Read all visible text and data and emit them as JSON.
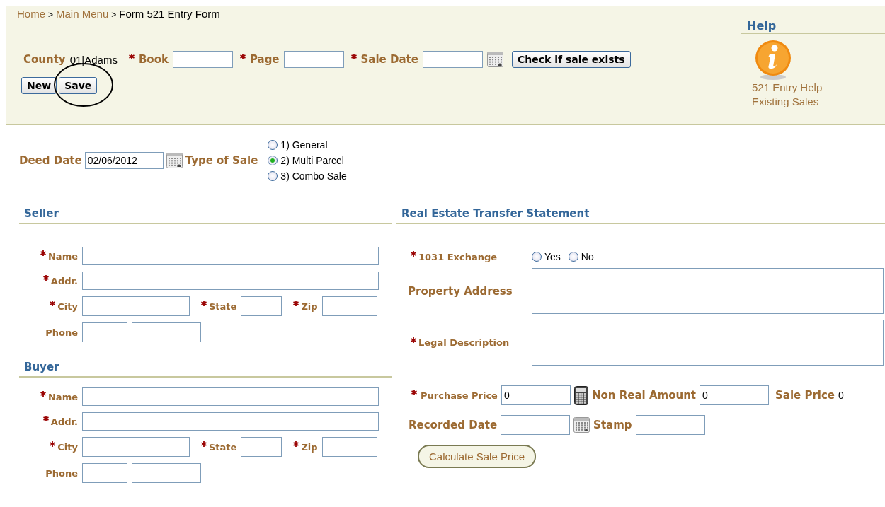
{
  "breadcrumb": {
    "separator": ">",
    "items": [
      {
        "label": "Home",
        "link": true
      },
      {
        "label": "Main Menu",
        "link": true
      },
      {
        "label": "Form 521 Entry Form",
        "link": false
      }
    ]
  },
  "header": {
    "county_label": "County",
    "county_value": "01|Adams",
    "fields": [
      {
        "label": "Book",
        "required": true,
        "calendar": false
      },
      {
        "label": "Page",
        "required": true,
        "calendar": false
      },
      {
        "label": "Sale Date",
        "required": true,
        "calendar": true
      }
    ],
    "check_button": "Check if sale exists",
    "buttons": [
      {
        "label": "New",
        "circled": false
      },
      {
        "label": "Save",
        "circled": true
      }
    ]
  },
  "help": {
    "title": "Help",
    "links": [
      "521 Entry Help",
      "Existing Sales"
    ]
  },
  "deed_date": {
    "label": "Deed Date",
    "value": "02/06/2012"
  },
  "type_of_sale": {
    "label": "Type of Sale",
    "options": [
      {
        "label": "1) General",
        "selected": false
      },
      {
        "label": "2) Multi Parcel",
        "selected": true
      },
      {
        "label": "3) Combo Sale",
        "selected": false
      }
    ]
  },
  "parties": [
    {
      "title": "Seller",
      "rows": [
        [
          {
            "label": "Name",
            "required": true,
            "kind": "long"
          }
        ],
        [
          {
            "label": "Addr.",
            "required": true,
            "kind": "long"
          }
        ],
        [
          {
            "label": "City",
            "required": true,
            "kind": "city"
          },
          {
            "label": "State",
            "required": true,
            "kind": "state"
          },
          {
            "label": "Zip",
            "required": true,
            "kind": "zip"
          }
        ],
        [
          {
            "label": "Phone",
            "required": false,
            "kind": "phone"
          }
        ]
      ]
    },
    {
      "title": "Buyer",
      "rows": [
        [
          {
            "label": "Name",
            "required": true,
            "kind": "long"
          }
        ],
        [
          {
            "label": "Addr.",
            "required": true,
            "kind": "long"
          }
        ],
        [
          {
            "label": "City",
            "required": true,
            "kind": "city"
          },
          {
            "label": "State",
            "required": true,
            "kind": "state"
          },
          {
            "label": "Zip",
            "required": true,
            "kind": "zip"
          }
        ],
        [
          {
            "label": "Phone",
            "required": false,
            "kind": "phone"
          }
        ]
      ]
    }
  ],
  "transfer": {
    "title": "Real Estate Transfer Statement",
    "exchange": {
      "label": "1031 Exchange",
      "required": true,
      "options": [
        {
          "label": "Yes",
          "selected": false
        },
        {
          "label": "No",
          "selected": false
        }
      ]
    },
    "textareas": [
      {
        "label": "Property Address",
        "required": false
      },
      {
        "label": "Legal Description",
        "required": true
      }
    ],
    "purchase_price": {
      "label": "Purchase Price",
      "required": true,
      "value": "0"
    },
    "non_real_amount": {
      "label": "Non Real Amount",
      "value": "0"
    },
    "sale_price": {
      "label": "Sale Price",
      "value": "0"
    },
    "recorded_date": {
      "label": "Recorded Date"
    },
    "stamp": {
      "label": "Stamp"
    },
    "calculate_button": "Calculate Sale Price"
  }
}
